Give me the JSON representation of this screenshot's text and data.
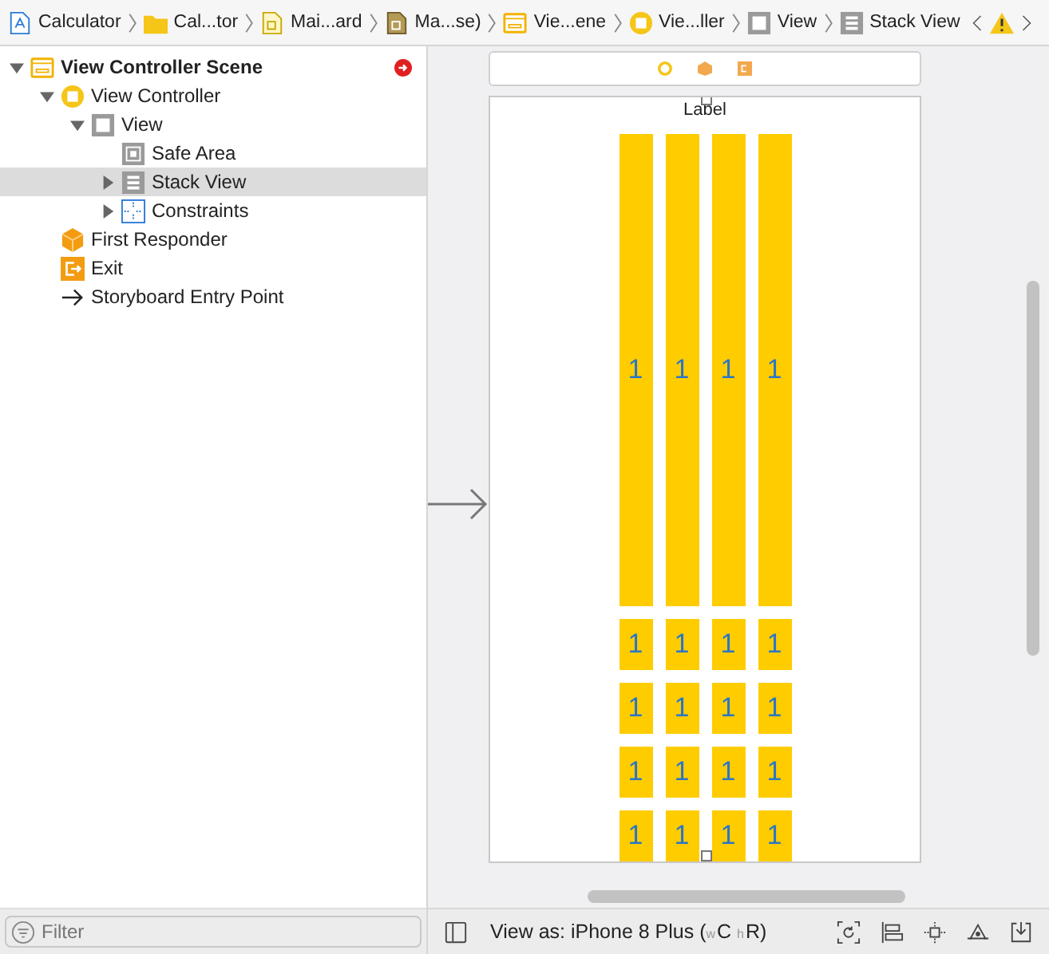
{
  "breadcrumbs": [
    {
      "label": "Calculator",
      "kind": "project"
    },
    {
      "label": "Cal...tor",
      "kind": "folder"
    },
    {
      "label": "Mai...ard",
      "kind": "storyboard"
    },
    {
      "label": "Ma...se)",
      "kind": "localized"
    },
    {
      "label": "Vie...ene",
      "kind": "scene"
    },
    {
      "label": "Vie...ller",
      "kind": "controller"
    },
    {
      "label": "View",
      "kind": "view"
    },
    {
      "label": "Stack View",
      "kind": "stack"
    }
  ],
  "outline": [
    {
      "label": "View Controller Scene",
      "kind": "scene",
      "expanded": true,
      "selected": false,
      "has_error": true,
      "children": [
        {
          "label": "View Controller",
          "kind": "controller",
          "expanded": true,
          "selected": false,
          "children": [
            {
              "label": "View",
              "kind": "view",
              "expanded": true,
              "selected": false,
              "children": [
                {
                  "label": "Safe Area",
                  "kind": "safearea",
                  "selected": false
                },
                {
                  "label": "Stack View",
                  "kind": "stack",
                  "expanded": false,
                  "selected": true
                },
                {
                  "label": "Constraints",
                  "kind": "constraints",
                  "expanded": false,
                  "selected": false
                }
              ]
            }
          ]
        },
        {
          "label": "First Responder",
          "kind": "responder",
          "selected": false
        },
        {
          "label": "Exit",
          "kind": "exit",
          "selected": false
        },
        {
          "label": "Storyboard Entry Point",
          "kind": "entry",
          "selected": false
        }
      ]
    }
  ],
  "filter": {
    "placeholder": "Filter"
  },
  "scene": {
    "label": "Label",
    "rows": [
      {
        "kind": "tall",
        "cells": [
          "1",
          "1",
          "1",
          "1"
        ]
      },
      {
        "kind": "short",
        "cells": [
          "1",
          "1",
          "1",
          "1"
        ]
      },
      {
        "kind": "short",
        "cells": [
          "1",
          "1",
          "1",
          "1"
        ]
      },
      {
        "kind": "short",
        "cells": [
          "1",
          "1",
          "1",
          "1"
        ]
      },
      {
        "kind": "short",
        "cells": [
          "1",
          "1",
          "1",
          "1"
        ]
      }
    ]
  },
  "view_as": {
    "text": "View as: iPhone 8 Plus (",
    "width_prefix": "w",
    "width_class": "C",
    "height_prefix": "h",
    "height_class": "R",
    "suffix": ")"
  }
}
